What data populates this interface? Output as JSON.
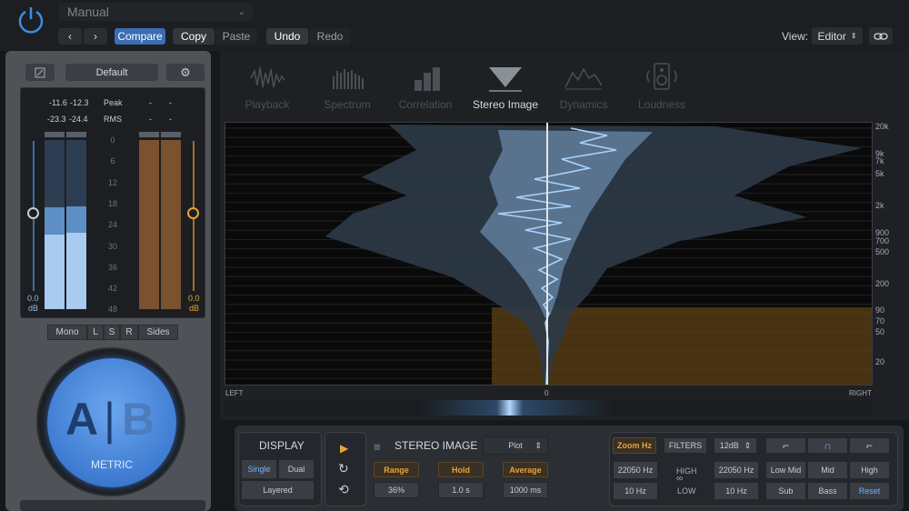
{
  "header": {
    "preset": "Manual",
    "compare": "Compare",
    "copy": "Copy",
    "paste": "Paste",
    "undo": "Undo",
    "redo": "Redo",
    "view_label": "View:",
    "view_value": "Editor",
    "nav_back": "‹",
    "nav_fwd": "›"
  },
  "meter": {
    "preset": "Default",
    "peak_l": "-11.6",
    "peak_r": "-12.3",
    "peak_label": "Peak",
    "peak_alt_l": "-",
    "peak_alt_r": "-",
    "rms_l": "-23.3",
    "rms_r": "-24.4",
    "rms_label": "RMS",
    "rms_alt_l": "-",
    "rms_alt_r": "-",
    "scale": [
      "0",
      "6",
      "12",
      "18",
      "24",
      "30",
      "36",
      "42",
      "48"
    ],
    "left_gain": "0.0",
    "left_unit": "dB",
    "right_gain": "0.0",
    "right_unit": "dB",
    "level_l_rms": 0.44,
    "level_l_peak": 0.6,
    "level_r_rms": 0.45,
    "level_r_peak": 0.61
  },
  "channels": {
    "mono": "Mono",
    "l": "L",
    "s": "S",
    "r": "R",
    "sides": "Sides"
  },
  "ab": {
    "a": "A",
    "sep": "|",
    "b": "B",
    "brand": "METRIC"
  },
  "tabs": [
    {
      "label": "Playback"
    },
    {
      "label": "Spectrum"
    },
    {
      "label": "Correlation"
    },
    {
      "label": "Stereo Image"
    },
    {
      "label": "Dynamics"
    },
    {
      "label": "Loudness"
    }
  ],
  "viz": {
    "freqs": [
      "20k",
      "9k",
      "7k",
      "5k",
      "2k",
      "900",
      "700",
      "500",
      "200",
      "90",
      "70",
      "50",
      "20"
    ],
    "left": "LEFT",
    "center": "0",
    "right": "RIGHT"
  },
  "controls": {
    "display": "DISPLAY",
    "single": "Single",
    "dual": "Dual",
    "layered": "Layered",
    "stereo_image": "STEREO IMAGE",
    "plot": "Plot",
    "range_label": "Range",
    "range_value": "36%",
    "hold_label": "Hold",
    "hold_value": "1.0 s",
    "average_label": "Average",
    "average_value": "1000 ms",
    "zoom": "Zoom Hz",
    "filters": "FILTERS",
    "slope": "12dB",
    "high_freq": "22050 Hz",
    "high_label": "HIGH",
    "low_freq": "10 Hz",
    "low_label": "LOW",
    "high_freq2": "22050 Hz",
    "low_freq2": "10 Hz",
    "low_mid": "Low Mid",
    "mid": "Mid",
    "high": "High",
    "sub": "Sub",
    "bass": "Bass",
    "reset": "Reset"
  },
  "colors": {
    "accent_blue": "#3a6db3",
    "accent_orange": "#e8a33a",
    "meter_blue": "#5d8fc4"
  }
}
